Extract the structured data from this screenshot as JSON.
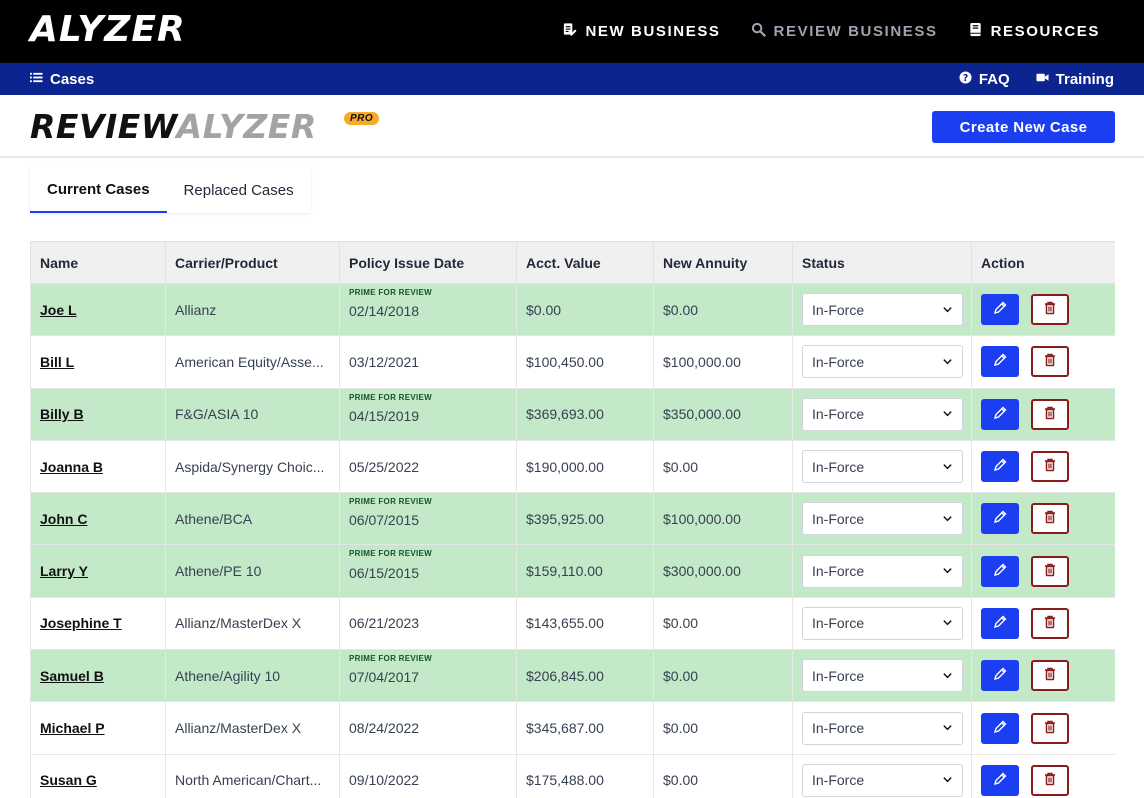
{
  "app": {
    "logo": "ALYZER"
  },
  "topnav": {
    "new_business": "NEW BUSINESS",
    "review_business": "REVIEW BUSINESS",
    "resources": "RESOURCES"
  },
  "subnav": {
    "cases": "Cases",
    "faq": "FAQ",
    "training": "Training"
  },
  "header": {
    "brand_part1": "REVIEW",
    "brand_part2": "ALYZER",
    "badge": "PRO",
    "create_button": "Create New Case"
  },
  "tabs": [
    {
      "label": "Current Cases",
      "active": true
    },
    {
      "label": "Replaced Cases",
      "active": false
    }
  ],
  "table": {
    "columns": [
      "Name",
      "Carrier/Product",
      "Policy Issue Date",
      "Acct. Value",
      "New Annuity",
      "Status",
      "Action"
    ],
    "prime_label": "PRIME FOR REVIEW",
    "rows": [
      {
        "name": "Joe L",
        "carrier": "Allianz",
        "date": "02/14/2018",
        "acct": "$0.00",
        "annuity": "$0.00",
        "status": "In-Force",
        "prime": true
      },
      {
        "name": "Bill L",
        "carrier": "American Equity/Asse...",
        "date": "03/12/2021",
        "acct": "$100,450.00",
        "annuity": "$100,000.00",
        "status": "In-Force",
        "prime": false
      },
      {
        "name": "Billy B",
        "carrier": "F&G/ASIA 10",
        "date": "04/15/2019",
        "acct": "$369,693.00",
        "annuity": "$350,000.00",
        "status": "In-Force",
        "prime": true
      },
      {
        "name": "Joanna B",
        "carrier": "Aspida/Synergy Choic...",
        "date": "05/25/2022",
        "acct": "$190,000.00",
        "annuity": "$0.00",
        "status": "In-Force",
        "prime": false
      },
      {
        "name": "John C",
        "carrier": "Athene/BCA",
        "date": "06/07/2015",
        "acct": "$395,925.00",
        "annuity": "$100,000.00",
        "status": "In-Force",
        "prime": true
      },
      {
        "name": "Larry Y",
        "carrier": "Athene/PE 10",
        "date": "06/15/2015",
        "acct": "$159,110.00",
        "annuity": "$300,000.00",
        "status": "In-Force",
        "prime": true
      },
      {
        "name": "Josephine T",
        "carrier": "Allianz/MasterDex X",
        "date": "06/21/2023",
        "acct": "$143,655.00",
        "annuity": "$0.00",
        "status": "In-Force",
        "prime": false
      },
      {
        "name": "Samuel B",
        "carrier": "Athene/Agility 10",
        "date": "07/04/2017",
        "acct": "$206,845.00",
        "annuity": "$0.00",
        "status": "In-Force",
        "prime": true
      },
      {
        "name": "Michael P",
        "carrier": "Allianz/MasterDex X",
        "date": "08/24/2022",
        "acct": "$345,687.00",
        "annuity": "$0.00",
        "status": "In-Force",
        "prime": false
      },
      {
        "name": "Susan G",
        "carrier": "North American/Chart...",
        "date": "09/10/2022",
        "acct": "$175,488.00",
        "annuity": "$0.00",
        "status": "In-Force",
        "prime": false
      }
    ]
  },
  "icons": {
    "new_business": "document-pen-icon",
    "review_business": "magnifier-icon",
    "resources": "book-icon",
    "cases": "list-icon",
    "faq": "question-circle-icon",
    "training": "video-camera-icon",
    "edit": "pencil-icon",
    "delete": "trash-icon",
    "select": "chevron-down-icon"
  },
  "colors": {
    "topbar": "#000000",
    "subbar": "#0c248f",
    "accent": "#1b3ff0",
    "prime_row": "#c3e9c9",
    "delete": "#8b1c1c",
    "badge": "#f7a928"
  }
}
